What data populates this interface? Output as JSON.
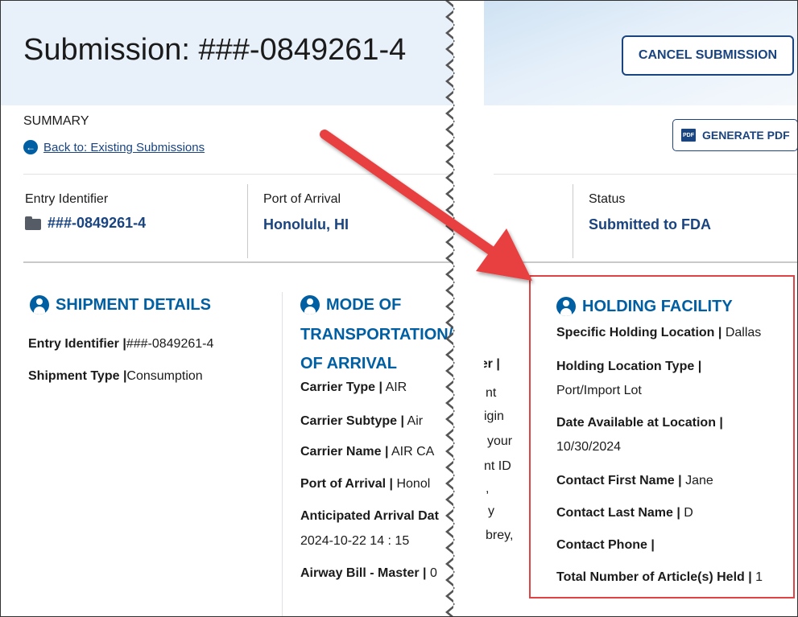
{
  "header": {
    "title": "Submission: ###-0849261-4",
    "cancel_label": "CANCEL SUBMISSION"
  },
  "summary": {
    "heading": "SUMMARY",
    "back_link": "Back to: Existing Submissions",
    "pdf_label": "GENERATE PDF",
    "entry_identifier_label": "Entry Identifier",
    "entry_identifier_value": "###-0849261-4",
    "port_label": "Port of Arrival",
    "port_value": "Honolulu, HI",
    "status_label": "Status",
    "status_value": "Submitted to FDA"
  },
  "shipment_details": {
    "title": "SHIPMENT DETAILS",
    "rows": [
      {
        "label": "Entry Identifier |",
        "value": "###-0849261-4"
      },
      {
        "label": "Shipment Type |",
        "value": "Consumption"
      }
    ]
  },
  "mode_of_transportation": {
    "title_lines": [
      "MODE OF",
      "TRANSPORTATION/",
      "OF ARRIVAL"
    ],
    "rows": [
      {
        "label": "Carrier Type |",
        "value": " AIR"
      },
      {
        "label": "Carrier Subtype |",
        "value": " Air"
      },
      {
        "label": "Carrier Name |",
        "value": " AIR CA"
      },
      {
        "label": "Port of Arrival |",
        "value": " Honol"
      },
      {
        "label": "Anticipated Arrival Dat",
        "value": ""
      },
      {
        "label": "",
        "value": "2024-10-22 14 : 15"
      },
      {
        "label": "Airway Bill - Master |",
        "value": " 0"
      }
    ]
  },
  "hidden_column_fragments": [
    "ber |",
    "nt",
    "igin",
    "your",
    "nt ID",
    ",",
    "y",
    "brey,"
  ],
  "holding_facility": {
    "title": "HOLDING FACILITY",
    "rows": [
      {
        "label": "Specific Holding Location |",
        "value": " Dallas"
      },
      {
        "label": "Holding Location Type |",
        "value": ""
      },
      {
        "label": "",
        "value": "Port/Import Lot"
      },
      {
        "label": "Date Available at Location |",
        "value": ""
      },
      {
        "label": "",
        "value": "10/30/2024"
      },
      {
        "label": "Contact First Name |",
        "value": " Jane"
      },
      {
        "label": "Contact Last Name |",
        "value": " D"
      },
      {
        "label": "Contact Phone |",
        "value": ""
      },
      {
        "label": "Total Number of Article(s) Held |",
        "value": " 1"
      }
    ]
  },
  "colors": {
    "primary": "#005ea2",
    "primary_dark": "#1a4480",
    "annotation_red": "#e04343"
  }
}
